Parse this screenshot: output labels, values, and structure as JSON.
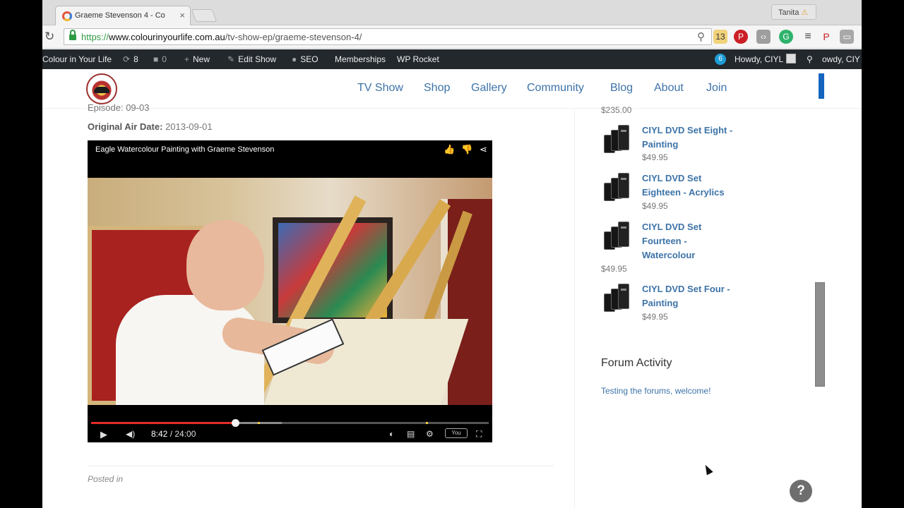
{
  "browser": {
    "tab_title": "Graeme Stevenson 4 - Co",
    "tab_close": "×",
    "profile_name": "Tanita",
    "url_scheme": "https://",
    "url_host": "www.colourinyourlife.com.au",
    "url_path": "/tv-show-ep/graeme-stevenson-4/",
    "ext_badge": "13"
  },
  "adminbar": {
    "site": "Colour in Your Life",
    "updates": "8",
    "comments": "0",
    "new": "New",
    "edit": "Edit Show",
    "seo": "SEO",
    "memberships": "Memberships",
    "rocket": "WP Rocket",
    "howdy": "Howdy, CIYL",
    "howdy_clip": "owdy, CIY"
  },
  "nav": {
    "items": [
      "TV Show",
      "Shop",
      "Gallery",
      "Community",
      "Blog",
      "About",
      "Join"
    ]
  },
  "main": {
    "episode_clip": "Episode: 09-03",
    "air_label": "Original Air Date:",
    "air_value": "2013-09-01",
    "video": {
      "title": "Eagle Watercolour Painting with Graeme Stevenson",
      "time_current": "8:42",
      "time_sep": " / ",
      "time_total": "24:00",
      "played_fraction": 0.3625,
      "buffered_fraction": 0.48
    },
    "posted_in": "Posted in"
  },
  "sidebar": {
    "top_price": "$235.00",
    "products": [
      {
        "title": "CIYL DVD Set Eight - Painting",
        "price": "$49.95"
      },
      {
        "title": "CIYL DVD Set Eighteen - Acrylics",
        "price": "$49.95"
      },
      {
        "title": "CIYL DVD Set Fourteen - Watercolour",
        "price": "$49.95"
      },
      {
        "title": "CIYL DVD Set Four - Painting",
        "price": "$49.95"
      }
    ],
    "forum_heading": "Forum Activity",
    "forum_link": "Testing the forums, welcome!"
  },
  "help_label": "?",
  "colors": {
    "link": "#3d73a8",
    "adminbar": "#23282d",
    "progress": "#e52d27",
    "accent_bar": "#1565c0"
  }
}
